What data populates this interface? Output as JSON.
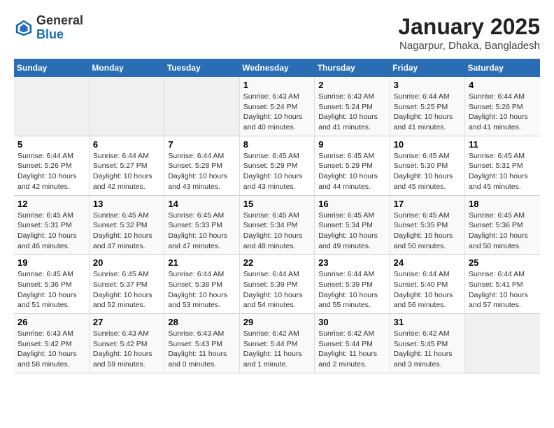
{
  "header": {
    "logo_general": "General",
    "logo_blue": "Blue",
    "month_year": "January 2025",
    "location": "Nagarpur, Dhaka, Bangladesh"
  },
  "days_of_week": [
    "Sunday",
    "Monday",
    "Tuesday",
    "Wednesday",
    "Thursday",
    "Friday",
    "Saturday"
  ],
  "weeks": [
    [
      {
        "day": "",
        "empty": true
      },
      {
        "day": "",
        "empty": true
      },
      {
        "day": "",
        "empty": true
      },
      {
        "day": "1",
        "sunrise": "6:43 AM",
        "sunset": "5:24 PM",
        "daylight": "10 hours and 40 minutes."
      },
      {
        "day": "2",
        "sunrise": "6:43 AM",
        "sunset": "5:24 PM",
        "daylight": "10 hours and 41 minutes."
      },
      {
        "day": "3",
        "sunrise": "6:44 AM",
        "sunset": "5:25 PM",
        "daylight": "10 hours and 41 minutes."
      },
      {
        "day": "4",
        "sunrise": "6:44 AM",
        "sunset": "5:26 PM",
        "daylight": "10 hours and 41 minutes."
      }
    ],
    [
      {
        "day": "5",
        "sunrise": "6:44 AM",
        "sunset": "5:26 PM",
        "daylight": "10 hours and 42 minutes."
      },
      {
        "day": "6",
        "sunrise": "6:44 AM",
        "sunset": "5:27 PM",
        "daylight": "10 hours and 42 minutes."
      },
      {
        "day": "7",
        "sunrise": "6:44 AM",
        "sunset": "5:28 PM",
        "daylight": "10 hours and 43 minutes."
      },
      {
        "day": "8",
        "sunrise": "6:45 AM",
        "sunset": "5:29 PM",
        "daylight": "10 hours and 43 minutes."
      },
      {
        "day": "9",
        "sunrise": "6:45 AM",
        "sunset": "5:29 PM",
        "daylight": "10 hours and 44 minutes."
      },
      {
        "day": "10",
        "sunrise": "6:45 AM",
        "sunset": "5:30 PM",
        "daylight": "10 hours and 45 minutes."
      },
      {
        "day": "11",
        "sunrise": "6:45 AM",
        "sunset": "5:31 PM",
        "daylight": "10 hours and 45 minutes."
      }
    ],
    [
      {
        "day": "12",
        "sunrise": "6:45 AM",
        "sunset": "5:31 PM",
        "daylight": "10 hours and 46 minutes."
      },
      {
        "day": "13",
        "sunrise": "6:45 AM",
        "sunset": "5:32 PM",
        "daylight": "10 hours and 47 minutes."
      },
      {
        "day": "14",
        "sunrise": "6:45 AM",
        "sunset": "5:33 PM",
        "daylight": "10 hours and 47 minutes."
      },
      {
        "day": "15",
        "sunrise": "6:45 AM",
        "sunset": "5:34 PM",
        "daylight": "10 hours and 48 minutes."
      },
      {
        "day": "16",
        "sunrise": "6:45 AM",
        "sunset": "5:34 PM",
        "daylight": "10 hours and 49 minutes."
      },
      {
        "day": "17",
        "sunrise": "6:45 AM",
        "sunset": "5:35 PM",
        "daylight": "10 hours and 50 minutes."
      },
      {
        "day": "18",
        "sunrise": "6:45 AM",
        "sunset": "5:36 PM",
        "daylight": "10 hours and 50 minutes."
      }
    ],
    [
      {
        "day": "19",
        "sunrise": "6:45 AM",
        "sunset": "5:36 PM",
        "daylight": "10 hours and 51 minutes."
      },
      {
        "day": "20",
        "sunrise": "6:45 AM",
        "sunset": "5:37 PM",
        "daylight": "10 hours and 52 minutes."
      },
      {
        "day": "21",
        "sunrise": "6:44 AM",
        "sunset": "5:38 PM",
        "daylight": "10 hours and 53 minutes."
      },
      {
        "day": "22",
        "sunrise": "6:44 AM",
        "sunset": "5:39 PM",
        "daylight": "10 hours and 54 minutes."
      },
      {
        "day": "23",
        "sunrise": "6:44 AM",
        "sunset": "5:39 PM",
        "daylight": "10 hours and 55 minutes."
      },
      {
        "day": "24",
        "sunrise": "6:44 AM",
        "sunset": "5:40 PM",
        "daylight": "10 hours and 56 minutes."
      },
      {
        "day": "25",
        "sunrise": "6:44 AM",
        "sunset": "5:41 PM",
        "daylight": "10 hours and 57 minutes."
      }
    ],
    [
      {
        "day": "26",
        "sunrise": "6:43 AM",
        "sunset": "5:42 PM",
        "daylight": "10 hours and 58 minutes."
      },
      {
        "day": "27",
        "sunrise": "6:43 AM",
        "sunset": "5:42 PM",
        "daylight": "10 hours and 59 minutes."
      },
      {
        "day": "28",
        "sunrise": "6:43 AM",
        "sunset": "5:43 PM",
        "daylight": "11 hours and 0 minutes."
      },
      {
        "day": "29",
        "sunrise": "6:42 AM",
        "sunset": "5:44 PM",
        "daylight": "11 hours and 1 minute."
      },
      {
        "day": "30",
        "sunrise": "6:42 AM",
        "sunset": "5:44 PM",
        "daylight": "11 hours and 2 minutes."
      },
      {
        "day": "31",
        "sunrise": "6:42 AM",
        "sunset": "5:45 PM",
        "daylight": "11 hours and 3 minutes."
      },
      {
        "day": "",
        "empty": true
      }
    ]
  ]
}
